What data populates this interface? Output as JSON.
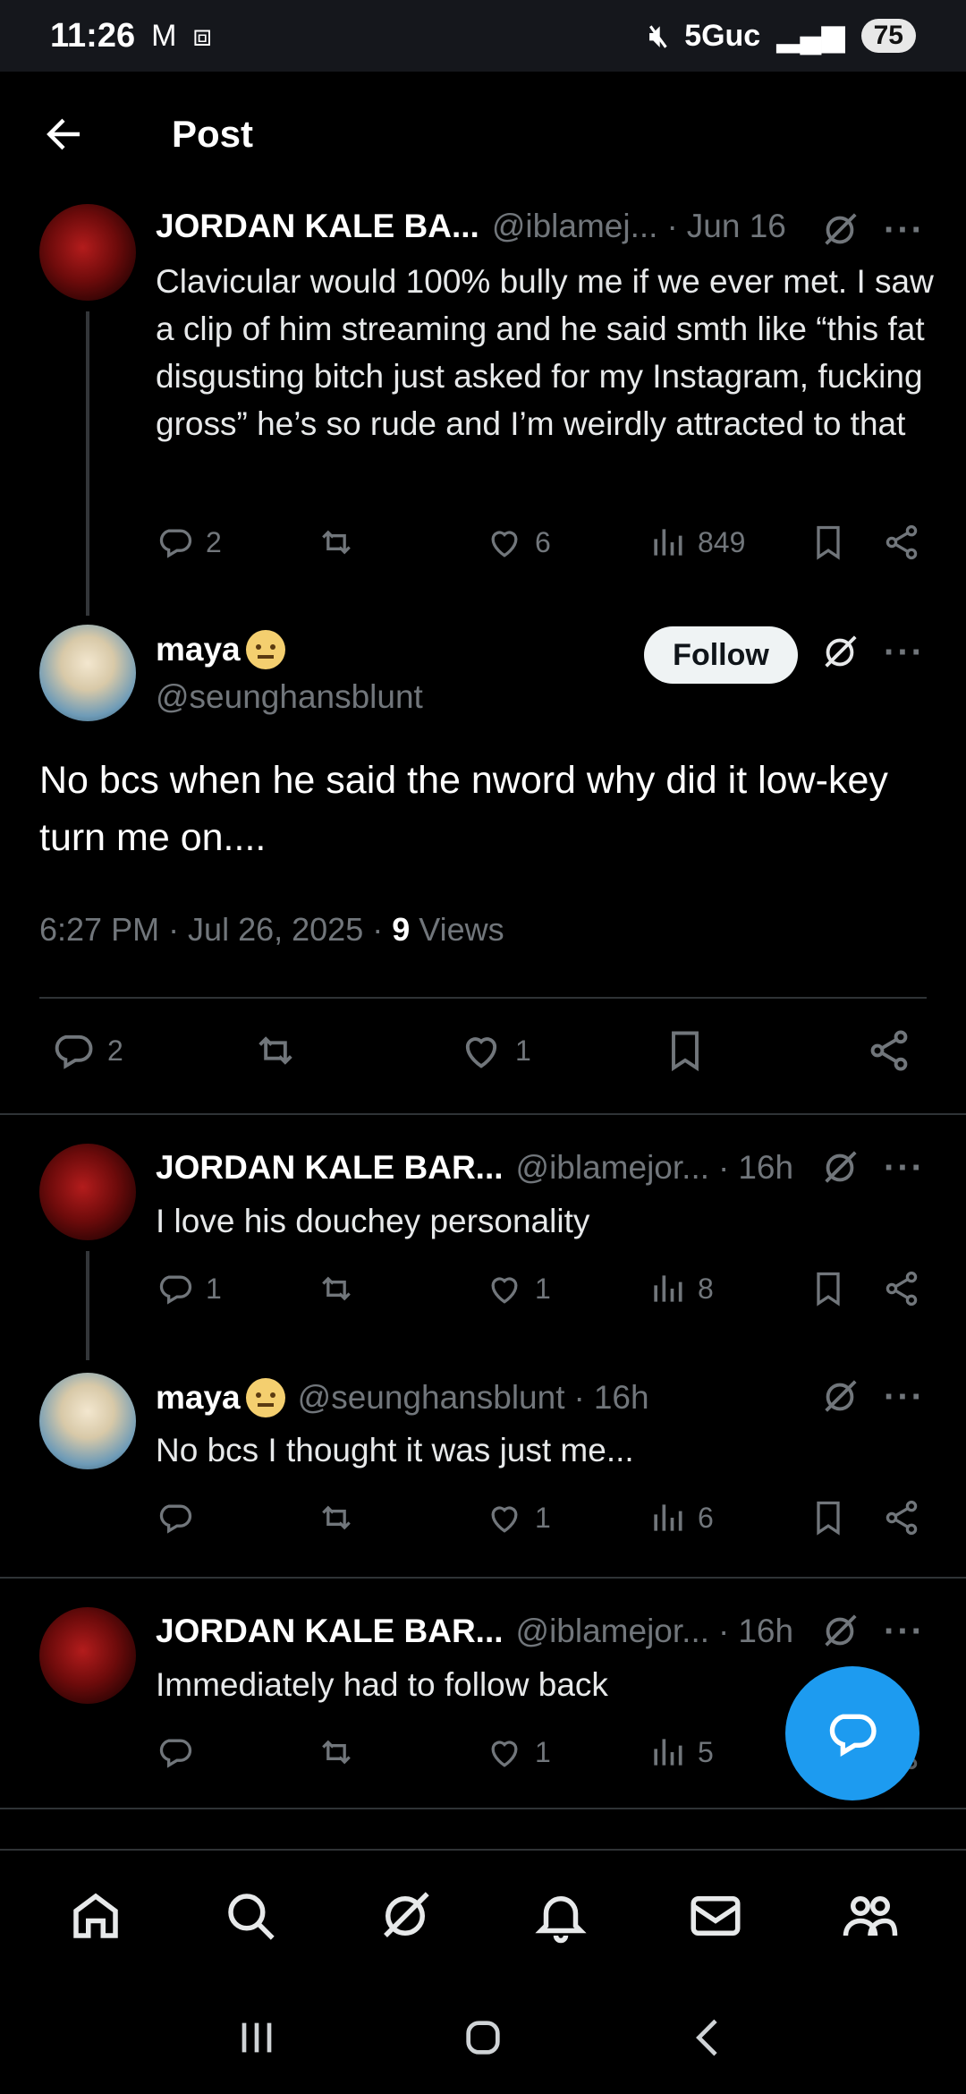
{
  "status_bar": {
    "time": "11:26",
    "network": "5Guc",
    "battery": "75"
  },
  "header": {
    "title": "Post"
  },
  "parent_tweet": {
    "name": "JORDAN KALE BA...",
    "handle": "@iblamej...",
    "time": "Jun 16",
    "text": "Clavicular would 100% bully me if we ever met. I saw a clip of him streaming and he said smth like “this fat disgusting bitch just asked for my Instagram, fucking gross” he’s so rude and I’m weirdly attracted to that",
    "replies": "2",
    "likes": "6",
    "views": "849"
  },
  "main_tweet": {
    "name": "maya",
    "handle": "@seunghansblunt",
    "follow_label": "Follow",
    "text": "No bcs when he said the nword why did it low-key turn me on....",
    "time": "6:27 PM · Jul 26, 2025 · ",
    "views_count": "9",
    "views_label": " Views",
    "replies": "2",
    "likes": "1"
  },
  "replies": [
    {
      "name": "JORDAN KALE BAR...",
      "handle": "@iblamejor...",
      "time": "16h",
      "text": "I love his douchey personality",
      "replies": "1",
      "likes": "1",
      "views": "8"
    },
    {
      "name": "maya",
      "handle": "@seunghansblunt",
      "time": "16h",
      "text": "No bcs I thought it was just me...",
      "replies": "",
      "likes": "1",
      "views": "6"
    },
    {
      "name": "JORDAN KALE BAR...",
      "handle": "@iblamejor...",
      "time": "16h",
      "text": "Immediately had to follow back",
      "replies": "",
      "likes": "1",
      "views": "5"
    }
  ],
  "nav": {
    "items": [
      "home-icon",
      "search-icon",
      "grok-icon",
      "notifications-icon",
      "messages-icon",
      "communities-icon"
    ]
  },
  "colors": {
    "accent": "#1d9bf0",
    "muted": "#71767b",
    "divider": "#2f3336"
  }
}
